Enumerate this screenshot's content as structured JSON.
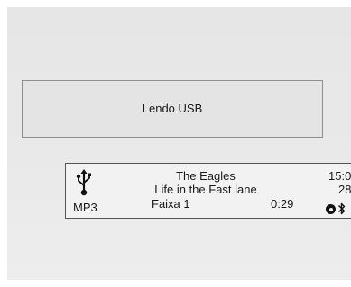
{
  "popup": {
    "text": "Lendo USB"
  },
  "status": {
    "source": "MP3",
    "artist": "The Eagles",
    "song": "Life in the Fast lane",
    "track": "Faixa 1",
    "elapsed": "0:29",
    "clock": "15:0",
    "temperature": "28°",
    "icons": [
      "usb-icon",
      "cd-icon",
      "bluetooth-icon"
    ]
  }
}
